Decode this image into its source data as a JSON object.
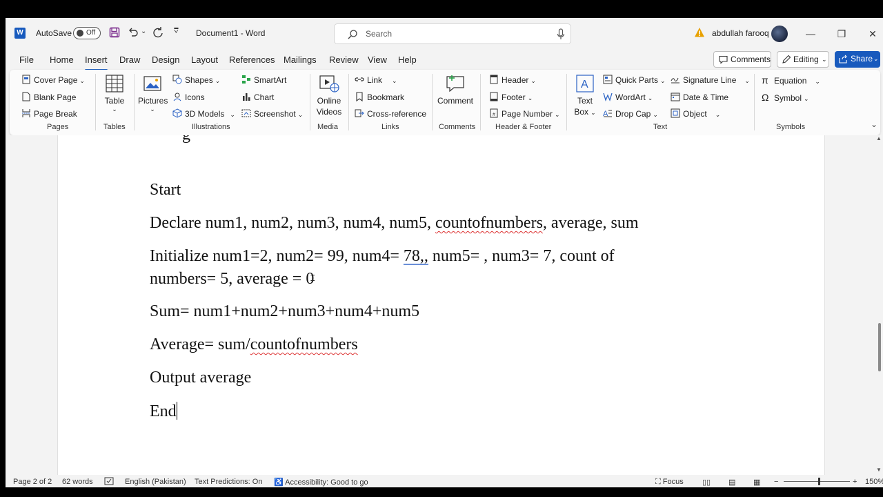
{
  "titlebar": {
    "autosave_label": "AutoSave",
    "autosave_state": "Off",
    "doc_title": "Document1  -  Word",
    "search_placeholder": "Search",
    "user_name": "abdullah farooq"
  },
  "menu": {
    "tabs": [
      "File",
      "Home",
      "Insert",
      "Draw",
      "Design",
      "Layout",
      "References",
      "Mailings",
      "Review",
      "View",
      "Help"
    ],
    "active_tab": "Insert",
    "comments_label": "Comments",
    "editing_label": "Editing",
    "share_label": "Share"
  },
  "ribbon": {
    "pages": {
      "label": "Pages",
      "items": [
        "Cover Page",
        "Blank Page",
        "Page Break"
      ]
    },
    "tables": {
      "label": "Tables",
      "table": "Table"
    },
    "illustrations": {
      "label": "Illustrations",
      "pictures": "Pictures",
      "items": [
        "Shapes",
        "Icons",
        "3D Models",
        "SmartArt",
        "Chart",
        "Screenshot"
      ]
    },
    "media": {
      "label": "Media",
      "online_videos_1": "Online",
      "online_videos_2": "Videos"
    },
    "links": {
      "label": "Links",
      "items": [
        "Link",
        "Bookmark",
        "Cross-reference"
      ]
    },
    "comments": {
      "label": "Comments",
      "comment": "Comment"
    },
    "header_footer": {
      "label": "Header & Footer",
      "items": [
        "Header",
        "Footer",
        "Page Number"
      ]
    },
    "text": {
      "label": "Text",
      "textbox_1": "Text",
      "textbox_2": "Box",
      "items": [
        "Quick Parts",
        "WordArt",
        "Drop Cap",
        "Signature Line",
        "Date & Time",
        "Object"
      ]
    },
    "symbols": {
      "label": "Symbols",
      "items": [
        "Equation",
        "Symbol"
      ]
    }
  },
  "document": {
    "p_start": "Start",
    "p_declare_a": "Declare num1, num2, num3, num4, num5, ",
    "p_declare_b": "countofnumbers",
    "p_declare_c": ", average, sum",
    "p_init_a": "Initialize num1=2, num2= 99, num4= ",
    "p_init_b": "78,,",
    "p_init_c": " num5= , num3= 7, count of",
    "p_init_line2": "numbers= 5, average = 0",
    "p_sum": "Sum= num1+num2+num3+num4+num5",
    "p_avg_a": "Average= sum/",
    "p_avg_b": "countofnumbers",
    "p_output": "Output average",
    "p_end": "End"
  },
  "status": {
    "page": "Page 2 of 2",
    "words": "62 words",
    "language": "English (Pakistan)",
    "text_predictions": "Text Predictions: On",
    "accessibility": "Accessibility: Good to go",
    "focus": "Focus",
    "zoom": "150%"
  },
  "colors": {
    "accent": "#185abd",
    "ribbon_bg": "#fbfbfb",
    "app_bg": "#f3f3f3"
  }
}
